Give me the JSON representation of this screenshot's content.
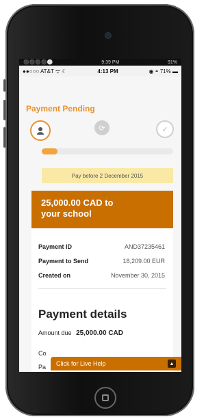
{
  "status_bar_outer": {
    "signal": "⚫⚫⚫⚫⚪",
    "time": "9:39 PM",
    "battery": "91%"
  },
  "status_bar_inner": {
    "carrier": "●●○○○ AT&T ᯤ ☾",
    "time": "4:13 PM",
    "battery": "71%"
  },
  "page": {
    "title": "Payment Pending",
    "steps": [
      {
        "icon": "person-icon",
        "state": "active"
      },
      {
        "icon": "refresh-icon",
        "state": "inactive"
      },
      {
        "icon": "check-icon",
        "state": "inactive"
      }
    ],
    "progress": 0.12,
    "notice": "Pay before 2 December 2015",
    "card": {
      "header_line1": "25,000.00 CAD to",
      "header_line2": "your school",
      "rows": [
        {
          "label": "Payment ID",
          "value": "AND37235461"
        },
        {
          "label": "Payment to Send",
          "value": "18,209.00 EUR"
        },
        {
          "label": "Created on",
          "value": "November 30, 2015"
        }
      ],
      "details_title": "Payment details",
      "amount_label": "Amount due",
      "amount_value": "25,000.00 CAD",
      "fragment1": "Co",
      "fragment2": "Pa"
    },
    "live_help": "Click for Live Help"
  },
  "colors": {
    "accent": "#e8912f",
    "header": "#c96f00",
    "notice_bg": "#f9e9a5",
    "progress_fill": "#f1a441"
  }
}
